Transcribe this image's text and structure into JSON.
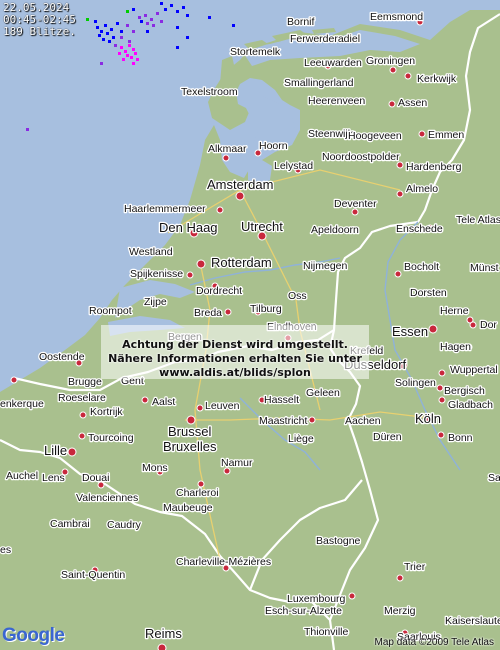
{
  "info": {
    "date": "22.05.2024",
    "time_range": "00:45-02:45",
    "strike_count": "189 Blitze."
  },
  "notice": {
    "line1": "Achtung der Dienst wird umgestellt.",
    "line2": "Nähere Informationen erhalten Sie unter",
    "line3": "www.aldis.at/blids/splon"
  },
  "credits": {
    "logo": "Google",
    "map_data": "Map data ©2009 Tele Atlas"
  },
  "colors": {
    "sea": "#a7bfdf",
    "land": "#a9c08e",
    "border": "#ffffff",
    "city_dot": "#c8283c",
    "strike_recent": "#ff00ff",
    "strike_mid": "#8a2be2",
    "strike_old": "#0000ff",
    "strike_newest": "#00cc00"
  },
  "cities": [
    {
      "name": "Bornif",
      "large": false
    },
    {
      "name": "Eemsmond",
      "large": false
    },
    {
      "name": "Ferwerderadiel",
      "large": false
    },
    {
      "name": "Stortemelk",
      "large": false
    },
    {
      "name": "Leeuwarden",
      "large": false
    },
    {
      "name": "Groningen",
      "large": false
    },
    {
      "name": "Kerkwijk",
      "large": false
    },
    {
      "name": "Smallingerland",
      "large": false
    },
    {
      "name": "Texelstroom",
      "large": false
    },
    {
      "name": "Heerenveen",
      "large": false
    },
    {
      "name": "Assen",
      "large": false
    },
    {
      "name": "Steenwijk",
      "large": false
    },
    {
      "name": "Hoogeveen",
      "large": false
    },
    {
      "name": "Emmen",
      "large": false
    },
    {
      "name": "Alkmaar",
      "large": false
    },
    {
      "name": "Hoorn",
      "large": false
    },
    {
      "name": "Noordoostpolder",
      "large": false
    },
    {
      "name": "Lelystad",
      "large": false
    },
    {
      "name": "Hardenberg",
      "large": false
    },
    {
      "name": "Amsterdam",
      "large": true
    },
    {
      "name": "Almelo",
      "large": false
    },
    {
      "name": "Haarlemmermeer",
      "large": false
    },
    {
      "name": "Deventer",
      "large": false
    },
    {
      "name": "Den Haag",
      "large": true
    },
    {
      "name": "Utrecht",
      "large": true
    },
    {
      "name": "Apeldoorn",
      "large": false
    },
    {
      "name": "Enschede",
      "large": false
    },
    {
      "name": "Tele Atlas",
      "large": false
    },
    {
      "name": "Westland",
      "large": false
    },
    {
      "name": "Rotterdam",
      "large": true
    },
    {
      "name": "Nijmegen",
      "large": false
    },
    {
      "name": "Bocholt",
      "large": false
    },
    {
      "name": "Münst",
      "large": false
    },
    {
      "name": "Spijkenisse",
      "large": false
    },
    {
      "name": "Dordrecht",
      "large": false
    },
    {
      "name": "Oss",
      "large": false
    },
    {
      "name": "Dorsten",
      "large": false
    },
    {
      "name": "Roompot",
      "large": false
    },
    {
      "name": "Zijpe",
      "large": false
    },
    {
      "name": "Breda",
      "large": false
    },
    {
      "name": "Tilburg",
      "large": false
    },
    {
      "name": "Herne",
      "large": false
    },
    {
      "name": "Bergen",
      "large": false
    },
    {
      "name": "Eindhoven",
      "large": false
    },
    {
      "name": "Essen",
      "large": true
    },
    {
      "name": "Dor",
      "large": false
    },
    {
      "name": "Krefeld",
      "large": false
    },
    {
      "name": "Hagen",
      "large": false
    },
    {
      "name": "Oostende",
      "large": false
    },
    {
      "name": "Brugge",
      "large": false
    },
    {
      "name": "Düsseldorf",
      "large": true
    },
    {
      "name": "Wuppertal",
      "large": false
    },
    {
      "name": "Gent",
      "large": false
    },
    {
      "name": "Solingen",
      "large": false
    },
    {
      "name": "enkerque",
      "large": false
    },
    {
      "name": "Roeselare",
      "large": false
    },
    {
      "name": "Aalst",
      "large": false
    },
    {
      "name": "Leuven",
      "large": false
    },
    {
      "name": "Hasselt",
      "large": false
    },
    {
      "name": "Geleen",
      "large": false
    },
    {
      "name": "Bergisch",
      "large": false
    },
    {
      "name": "Gladbach",
      "large": false
    },
    {
      "name": "Kortrijk",
      "large": false
    },
    {
      "name": "Köln",
      "large": true
    },
    {
      "name": "Tourcoing",
      "large": false
    },
    {
      "name": "Brussel",
      "large": true
    },
    {
      "name": "Bruxelles",
      "large": true
    },
    {
      "name": "Maastricht",
      "large": false
    },
    {
      "name": "Aachen",
      "large": false
    },
    {
      "name": "Düren",
      "large": false
    },
    {
      "name": "Bonn",
      "large": false
    },
    {
      "name": "Lille",
      "large": true
    },
    {
      "name": "Liège",
      "large": false
    },
    {
      "name": "Lens",
      "large": false
    },
    {
      "name": "Douai",
      "large": false
    },
    {
      "name": "Mons",
      "large": false
    },
    {
      "name": "Namur",
      "large": false
    },
    {
      "name": "Auchel",
      "large": false
    },
    {
      "name": "Valenciennes",
      "large": false
    },
    {
      "name": "Charleroi",
      "large": false
    },
    {
      "name": "Maubeuge",
      "large": false
    },
    {
      "name": "Cambrai",
      "large": false
    },
    {
      "name": "Caudry",
      "large": false
    },
    {
      "name": "Bastogne",
      "large": false
    },
    {
      "name": "Saint-Quentin",
      "large": false
    },
    {
      "name": "Charleville-Mézières",
      "large": false
    },
    {
      "name": "Trier",
      "large": false
    },
    {
      "name": "Luxembourg",
      "large": false
    },
    {
      "name": "Esch-sur-Alzette",
      "large": false
    },
    {
      "name": "Kaiserslautern",
      "large": false
    },
    {
      "name": "Merzig",
      "large": false
    },
    {
      "name": "Thionville",
      "large": false
    },
    {
      "name": "Saarlouis",
      "large": false
    },
    {
      "name": "Reims",
      "large": true
    },
    {
      "name": "es",
      "large": false
    },
    {
      "name": "Sa",
      "large": false
    }
  ]
}
